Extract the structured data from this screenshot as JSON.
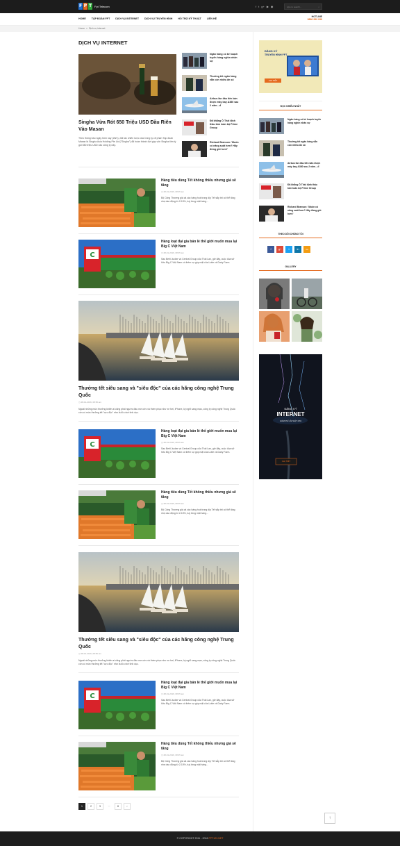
{
  "header": {
    "logo_letters": [
      "F",
      "P",
      "T"
    ],
    "logo_text": "Fpt Telecom",
    "socials": [
      "f",
      "t",
      "g+",
      "▶",
      "◉"
    ],
    "search_placeholder": "type to search...",
    "search_icon": "search-icon"
  },
  "nav": {
    "items": [
      "HOME",
      "TẬP ĐOÀN FPT",
      "DỊCH VỤ INTERNET",
      "DỊCH VỤ TRUYỀN HÌNH",
      "HỖ TRỢ KỸ THUẬT",
      "LIÊN HỆ"
    ],
    "hotline_label": "HOTLINE",
    "hotline_number": "0866 999 099"
  },
  "breadcrumb": {
    "home": "Home",
    "sep": "»",
    "current": "Dịch vụ internet"
  },
  "page_title": "DỊCH VỤ INTERNET",
  "featured": {
    "title": "Singha Vừa Rót 650 Triệu USD Đầu Riên Vào Masan",
    "desc": "Theo thông báo ngày hôm nay (28/1), đối tác chiến lược của Công ty cổ phần Tập đoàn Masan là Singha Asia Holding Pte Ltd (\"Singha\") đã hoàn thành đợt góp vốn Singha tiền tỷ gói 650 triệu USD vào công ty này."
  },
  "featured_side": [
    "Ngân hàng có kế hoạch tuyển hàng nghìn nhân sự",
    "Thưởng tết ngân hàng vẫn còn nhiều ẩn số",
    "Airbus lần đầu tiên bán được máy bay A380 sau 2 năm…đ",
    "Đã khẳng Ô Thái định thâu tóm toàn bộ Prime Group",
    "Richard Branson: 'Muốn có năng suất hơn? Hãy đừng giờ hơn!'"
  ],
  "posts": [
    {
      "title": "Hàng tiêu dùng  Tết không thiếu nhưng giá sẽ tăng",
      "meta": "◷ 28-01-2016, 08:35 am",
      "desc": "Bộ Công Thương giá cả các hàng hoá trong dịp Tết sắp tới có thể tăng nhẹ dao động từ 2-15%, tuỳ từng mặt hàng..."
    },
    {
      "title": "Hàng loạt đại gia bán lẻ thế giới muốn mua lại Big C Việt Nam",
      "meta": "◷ 28-01-2016, 08:35 am",
      "desc": "Sau Berli Jucker và Central Group của Thái Lan, giờ đây, cuộc đua sở hữu Big C Việt Nam có thêm sự góp mặt của Lotte và Dairy Farm."
    },
    {
      "title": "Thưởng tết siêu sang và \"siêu độc\" của các hãng công nghệ Trung Quốc",
      "meta": "◷ 28-01-2016, 08:35 am",
      "desc": "Ngoài những mức thưởng khiến ai cũng phải ngước đầu mơ ước và thèm phục như xe hơi, iPhone, kỳ nghỉ sang mạo, công ty công nghệ Trung Quốc còn có mức thưởng tết \"cực độc\" như là đồ chơi tình dục."
    },
    {
      "title": "Hàng loạt đại gia bán lẻ thế giới muốn mua lại Big C Việt Nam",
      "meta": "◷ 28-01-2016, 08:35 am",
      "desc": "Sau Berli Jucker và Central Group của Thái Lan, giờ đây, cuộc đua sở hữu Big C Việt Nam có thêm sự góp mặt của Lotte và Dairy Farm."
    },
    {
      "title": "Hàng tiêu dùng  Tết không thiếu nhưng giá sẽ tăng",
      "meta": "◷ 28-01-2016, 08:35 am",
      "desc": "Bộ Công Thương giá cả các hàng hoá trong dịp Tết sắp tới có thể tăng nhẹ dao động từ 2-15%, tuỳ từng mặt hàng..."
    },
    {
      "title": "Thưởng tết siêu sang và \"siêu độc\" của các hãng công nghệ Trung Quốc",
      "meta": "◷ 28-01-2016, 08:35 am",
      "desc": "Ngoài những mức thưởng khiến ai cũng phải ngước đầu mơ ước và thèm phục như xe hơi, iPhone, kỳ nghỉ sang mạo, công ty công nghệ Trung Quốc còn có mức thưởng tết \"cực độc\" như là đồ chơi tình dục."
    },
    {
      "title": "Hàng loạt đại gia bán lẻ thế giới muốn mua lại Big C Việt Nam",
      "meta": "◷ 28-01-2016, 08:35 am",
      "desc": "Sau Berli Jucker và Central Group của Thái Lan, giờ đây, cuộc đua sở hữu Big C Việt Nam có thêm sự góp mặt của Lotte và Dairy Farm."
    },
    {
      "title": "Hàng tiêu dùng  Tết không thiếu nhưng giá sẽ tăng",
      "meta": "◷ 28-01-2016, 08:35 am",
      "desc": "Bộ Công Thương giá cả các hàng hoá trong dịp Tết sắp tới có thể tăng nhẹ dao động từ 2-15%, tuỳ từng mặt hàng..."
    }
  ],
  "pagination": [
    "1",
    "2",
    "3",
    "...",
    "8",
    "›"
  ],
  "sidebar": {
    "banner1_line1": "ĐĂNG KÝ",
    "banner1_line2": "TRUYỀN HÌNH FPT",
    "banner1_btn": "CHI TIẾT",
    "popular_heading": "ĐỌC NHIỀU NHẤT",
    "popular": [
      "Ngân hàng có kế hoạch tuyển hàng nghìn nhân sự",
      "Thưởng tết ngân hàng vẫn còn nhiều ẩn số",
      "Airbus lần đầu tiên bán được máy bay A380 sau 2 năm…đ",
      "Đã khẳng Ô Thái định thâu tóm toàn bộ Prime Group",
      "Richard Branson: 'Muốn có năng suất hơn? Hãy đừng giờ hơn!'"
    ],
    "follow_heading": "THEO DÕI CHÚNG TÔI",
    "follow_icons": [
      "f",
      "g+",
      "t",
      "in",
      "rss"
    ],
    "gallery_heading": "GALLERY",
    "banner2_line1": "ĐĂNG KÝ",
    "banner2_line2": "INTERNET",
    "banner2_line3": "GIẢM PHÍ LẮP ĐẶT 20%",
    "banner2_btn": "CHI TIẾT"
  },
  "footer": {
    "copyright": "© COPYRIGHT 2011 - 2016 ",
    "brand": "FPT123.NET"
  },
  "colors": {
    "accent": "#e56a1e",
    "dark": "#1c1c1c",
    "fb": "#3b5998",
    "gplus": "#dd4b39",
    "twitter": "#1da1f2",
    "linkedin": "#0e76a8",
    "rss": "#f39c12"
  }
}
